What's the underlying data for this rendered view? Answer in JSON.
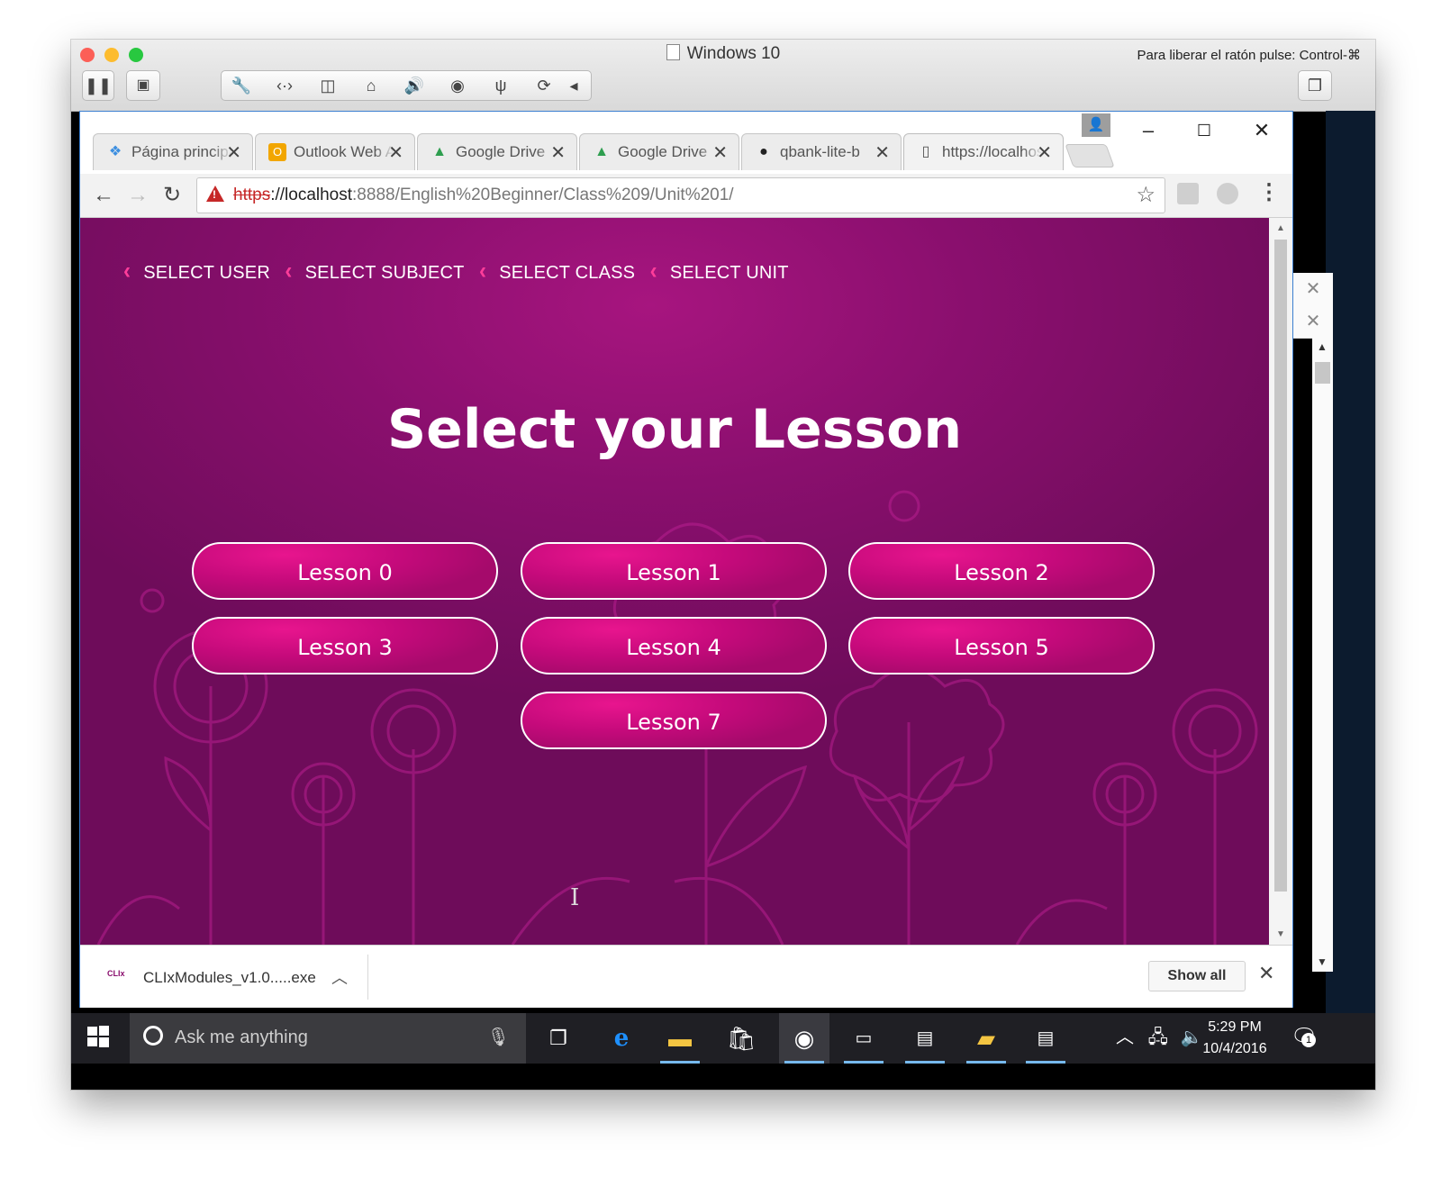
{
  "vm": {
    "title": "Windows 10",
    "release_hint": "Para liberar el ratón pulse: Control-⌘"
  },
  "browser": {
    "tabs": [
      {
        "label": "Página principal",
        "icon": "dropbox-icon"
      },
      {
        "label": "Outlook Web App",
        "icon": "outlook-icon"
      },
      {
        "label": "Google Drive",
        "icon": "google-drive-icon"
      },
      {
        "label": "Google Drive",
        "icon": "google-drive-icon"
      },
      {
        "label": "qbank-lite-b",
        "icon": "github-icon"
      },
      {
        "label": "https://localhost",
        "icon": "page-icon"
      }
    ],
    "url": {
      "scheme": "https",
      "rest_host": "://localhost",
      "rest_path": ":8888/English%20Beginner/Class%209/Unit%201/"
    }
  },
  "page": {
    "breadcrumb": [
      "SELECT USER",
      "SELECT SUBJECT",
      "SELECT CLASS",
      "SELECT UNIT"
    ],
    "title": "Select your Lesson",
    "lessons": [
      "Lesson 0",
      "Lesson 1",
      "Lesson 2",
      "Lesson 3",
      "Lesson 4",
      "Lesson 5",
      "Lesson 7"
    ]
  },
  "downloads": {
    "file_name": "CLIxModules_v1.0.....exe",
    "file_icon_text": "CLIx",
    "show_all": "Show all"
  },
  "taskbar": {
    "search_placeholder": "Ask me anything",
    "time": "5:29 PM",
    "date": "10/4/2016",
    "notifications": "1"
  },
  "colors": {
    "page_bg": "#8a0f6e",
    "button_fill": "#c50a7b",
    "breadcrumb_chevron": "#ff3d9a"
  }
}
